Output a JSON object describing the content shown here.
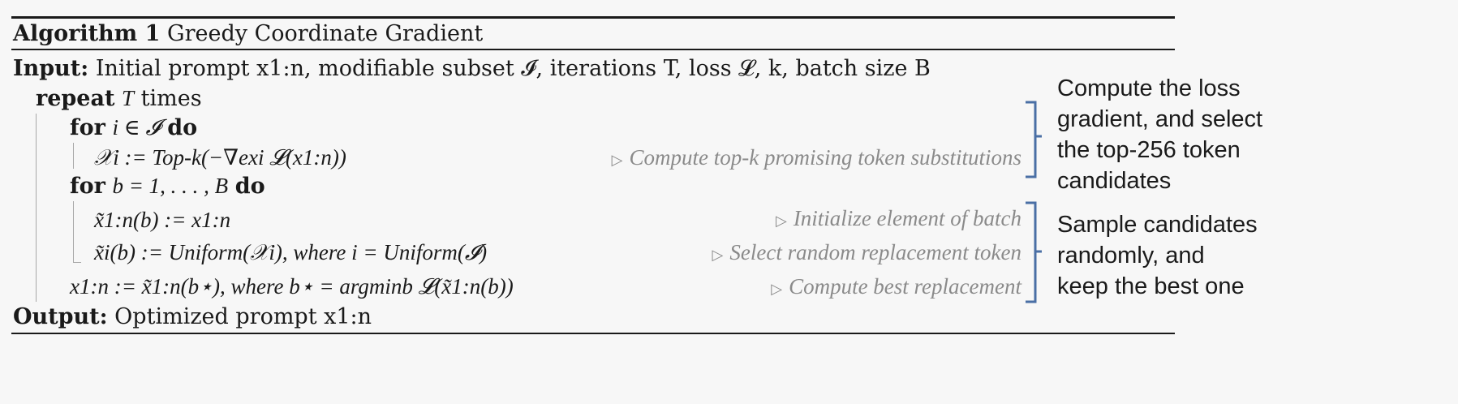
{
  "algorithm": {
    "label": "Algorithm 1",
    "title": "Greedy Coordinate Gradient",
    "input_kw": "Input:",
    "input_text": "Initial prompt x1:n, modifiable subset 𝓘, iterations T, loss 𝓛, k, batch size B",
    "repeat_kw": "repeat",
    "repeat_var": "T",
    "repeat_tail": "times",
    "for1_kw": "for",
    "for1_cond": "i ∈ 𝓘",
    "for1_do": "do",
    "line_topk": "𝒳i := Top-k(−∇exi 𝓛(x1:n))",
    "comment_topk": "Compute top-k promising token substitutions",
    "for2_kw": "for",
    "for2_cond": "b = 1, . . . , B",
    "for2_do": "do",
    "line_init": "x̃1:n(b) := x1:n",
    "comment_init": "Initialize element of batch",
    "line_select": "x̃i(b) := Uniform(𝒳i), where i = Uniform(𝓘)",
    "comment_select": "Select random replacement token",
    "line_best": "x1:n := x̃1:n(b⋆), where b⋆ = argminb 𝓛(x̃1:n(b))",
    "comment_best": "Compute best replacement",
    "output_kw": "Output:",
    "output_text": "Optimized prompt x1:n"
  },
  "annotations": {
    "note1": "Compute the loss\ngradient, and select\nthe top-256 token\ncandidates",
    "note2": "Sample candidates\nrandomly, and\nkeep the best one",
    "brace_color": "#4a6fa5"
  }
}
